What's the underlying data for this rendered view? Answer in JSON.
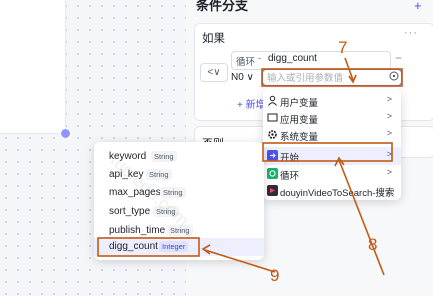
{
  "panel": {
    "title": "条件分支",
    "add_label": "+",
    "if_label": "如果",
    "more_label": "···",
    "logic_operator": "<∨",
    "left_field": {
      "source_tag": "循环",
      "arrow": "-",
      "value": "digg_count"
    },
    "remove_label": "−",
    "operator": "N0 ∨",
    "value_placeholder": "输入或引用参数值",
    "add_condition_label": "+ 新增",
    "else_label": "否则"
  },
  "ref_menu": {
    "items": [
      {
        "label": "用户变量",
        "icon": "person-icon"
      },
      {
        "label": "应用变量",
        "icon": "folder-icon"
      },
      {
        "label": "系统变量",
        "icon": "gear-icon"
      },
      {
        "label": "开始",
        "icon": "start-node-icon",
        "active": true
      },
      {
        "label": "循环",
        "icon": "loop-node-icon"
      },
      {
        "label": "douyinVideoToSearch-搜索",
        "icon": "plugin-node-icon"
      }
    ],
    "chevron": ">"
  },
  "variables": [
    {
      "name": "keyword",
      "type": "String"
    },
    {
      "name": "api_key",
      "type": "String"
    },
    {
      "name": "max_pages",
      "type": "String"
    },
    {
      "name": "sort_type",
      "type": "String"
    },
    {
      "name": "publish_time",
      "type": "String"
    },
    {
      "name": "digg_count",
      "type": "Integer",
      "active": true
    }
  ],
  "annotations": {
    "step7": "7",
    "step8": "8",
    "step9": "9",
    "color": "#c35a14"
  },
  "accent_color": "#4d53e8",
  "watermark": "tuoledu.com"
}
